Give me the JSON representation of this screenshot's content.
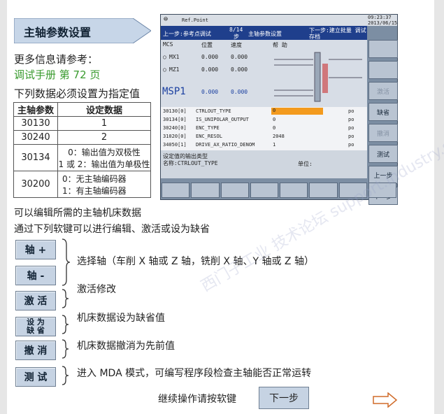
{
  "title": "主轴参数设置",
  "info": {
    "line1": "更多信息请参考：",
    "line2": "调试手册 第 72 页",
    "line3": "下列数据必须设置为指定值"
  },
  "table": {
    "headers": [
      "主轴参数",
      "设定数据"
    ],
    "rows": [
      [
        "30130",
        "1"
      ],
      [
        "30240",
        "2"
      ],
      [
        "30134",
        "0：输出值为双极性\n1 或 2：输出值为单极性"
      ],
      [
        "30200",
        "0：无主轴编码器\n1：有主轴编码器"
      ]
    ]
  },
  "screen": {
    "time": "09:23:37",
    "date": "2013/06/15",
    "refpoint": "Ref.Point",
    "nav_prev": "上一步:参考点调试",
    "nav_page": "8/14",
    "nav_page2": "步",
    "nav_title": "主轴参数设置",
    "nav_next": "下一步:建立批量 调试存档",
    "mcs": "MCS",
    "col_pos": "位置",
    "col_speed": "速度",
    "help": "帮 助",
    "axes": [
      {
        "name": "MX1",
        "pos": "0.000",
        "speed": "0.000"
      },
      {
        "name": "MZ1",
        "pos": "0.000",
        "speed": "0.000"
      }
    ],
    "msp": "MSP1",
    "msp_pos": "0.000",
    "msp_speed": "0.000",
    "md_rows": [
      {
        "no": "30130[0]",
        "name": "CTRLOUT_TYPE",
        "val": "0",
        "unit": "po"
      },
      {
        "no": "30134[0]",
        "name": "IS_UNIPOLAR_OUTPUT",
        "val": "0",
        "unit": "po"
      },
      {
        "no": "30240[0]",
        "name": "ENC_TYPE",
        "val": "0",
        "unit": "po"
      },
      {
        "no": "31020[0]",
        "name": "ENC_RESOL",
        "val": "2048",
        "unit": "po"
      },
      {
        "no": "34050[1]",
        "name": "DRIVE_AX_RATIO_DENOM",
        "val": "1",
        "unit": "po"
      }
    ],
    "desc1": "设定值的输出类型",
    "desc2": "名称:CTRLOUT_TYPE",
    "desc_unit": "单位:",
    "softkeys": [
      "",
      "",
      "激活",
      "缺省",
      "撤消",
      "测试",
      "上一步",
      "下一步"
    ]
  },
  "para1": "可以编辑所需的主轴机床数据",
  "para2": "通过下列软键可以进行编辑、激活或设为缺省",
  "buttons": {
    "axis_plus": "轴 +",
    "axis_minus": "轴 -",
    "activate": "激 活",
    "default_l1": "设 为",
    "default_l2": "缺 省",
    "undo": "撤 消",
    "test": "测 试"
  },
  "descs": {
    "select_axis": "选择轴（车削 X 轴或 Z 轴，铣削 X 轴、Y 轴或 Z 轴）",
    "activate": "激活修改",
    "default": "机床数据设为缺省值",
    "undo": "机床数据撤消为先前值",
    "test": "进入 MDA 模式，可编写程序段检查主轴能否正常运转"
  },
  "continue_label": "继续操作请按软键",
  "next_label": "下一步",
  "watermark": "西门子工业 技术论坛 support.industry.siemens.com/cs"
}
